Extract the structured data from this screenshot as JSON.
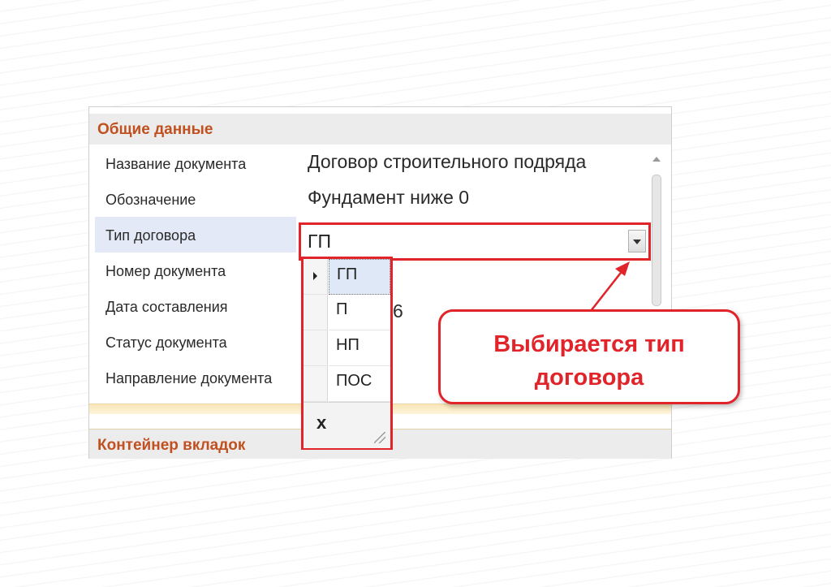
{
  "colors": {
    "accent": "#e0242a",
    "group_header_text": "#c0501f",
    "selected_row_bg": "#e3e9f7"
  },
  "sections": {
    "general_title": "Общие данные",
    "tabs_container_title": "Контейнер вкладок"
  },
  "properties": [
    {
      "label": "Название документа",
      "value": "Договор строительного подряда"
    },
    {
      "label": "Обозначение",
      "value": "Фундамент ниже 0"
    },
    {
      "label": "Тип договора",
      "value": "ГП"
    },
    {
      "label": "Номер документа",
      "value": ""
    },
    {
      "label": "Дата составления",
      "value": ""
    },
    {
      "label": "Статус документа",
      "value": ""
    },
    {
      "label": "Направление документа",
      "value": ""
    }
  ],
  "obscured_value_fragment": "6",
  "contract_type_dropdown": {
    "options": [
      "ГП",
      "П",
      "НП",
      "ПОС"
    ],
    "selected": "ГП",
    "close_label": "x"
  },
  "callout": {
    "line1": "Выбирается тип",
    "line2": "договора"
  },
  "icons": {
    "dropdown_arrow": "chevron-down-icon",
    "close": "close-icon",
    "resize": "resize-grip-icon",
    "row_indicator": "row-pointer-icon"
  }
}
